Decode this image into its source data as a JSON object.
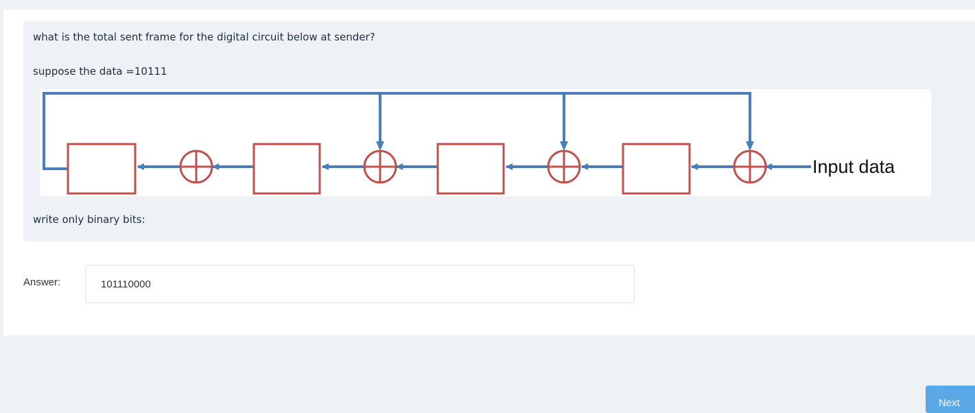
{
  "question": {
    "line1": "what is the total sent frame for the digital circuit below at sender?",
    "line2": "suppose the data =10111",
    "instruction": "write only binary bits:"
  },
  "diagram": {
    "input_label": "Input data",
    "register_count": 4,
    "xor_count": 4,
    "colors": {
      "wire": "#4a7ebb",
      "component": "#c0504d"
    }
  },
  "answer": {
    "label": "Answer:",
    "value": "101110000"
  },
  "navigation": {
    "next_label": "Next"
  }
}
